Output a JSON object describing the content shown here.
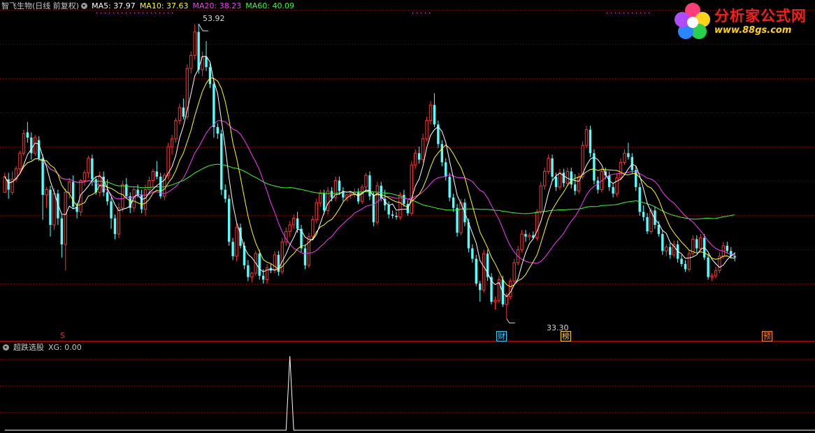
{
  "header": {
    "stock_name": "智飞生物(日线 前复权)",
    "ma_items": [
      {
        "label": "MA5: 37.97",
        "color": "#ffffff"
      },
      {
        "label": "MA10: 37.63",
        "color": "#ffff00"
      },
      {
        "label": "MA20: 38.23",
        "color": "#ff33ff"
      },
      {
        "label": "MA60: 40.09",
        "color": "#33ff33"
      }
    ]
  },
  "logo": {
    "text": "分析家公式网",
    "url": "www.88gs.com"
  },
  "annotations": {
    "high_label": "53.92",
    "low_label": "33.30"
  },
  "markers": [
    {
      "label": "S",
      "color": "#ff2020"
    },
    {
      "label": "财",
      "color": "#33ccff"
    },
    {
      "label": "榜",
      "color": "#ffcc33"
    },
    {
      "label": "预",
      "color": "#ff8833"
    }
  ],
  "indicator": {
    "title": "超跌选股",
    "value_label": "XG: 0.00"
  },
  "colors": {
    "up": "#ff3232",
    "down": "#54ffff",
    "grid": "#8a0000",
    "axis": "#c00000"
  },
  "chart_data": {
    "type": "candlestick",
    "ylim": [
      31,
      55
    ],
    "ohlc": [
      [
        41.0,
        42.5,
        41.2,
        42.2
      ],
      [
        42.0,
        42.5,
        40.5,
        41.2
      ],
      [
        41.0,
        42.6,
        40.8,
        42.0
      ],
      [
        42.0,
        43.0,
        41.8,
        42.8
      ],
      [
        42.8,
        44.2,
        42.5,
        44.0
      ],
      [
        44.0,
        45.8,
        43.8,
        45.5
      ],
      [
        45.6,
        46.4,
        44.8,
        45.2
      ],
      [
        45.2,
        45.6,
        43.5,
        44.0
      ],
      [
        44.0,
        45.4,
        43.8,
        45.2
      ],
      [
        45.0,
        45.3,
        43.4,
        43.6
      ],
      [
        43.6,
        43.9,
        38.9,
        40.8
      ],
      [
        40.8,
        41.4,
        39.8,
        41.2
      ],
      [
        41.2,
        41.5,
        37.6,
        38.5
      ],
      [
        38.5,
        41.3,
        38.1,
        40.9
      ],
      [
        40.9,
        41.2,
        38.5,
        39.0
      ],
      [
        39.0,
        39.3,
        36.0,
        37.0
      ],
      [
        37.0,
        41.3,
        35.0,
        41.0
      ],
      [
        41.0,
        42.1,
        40.5,
        41.8
      ],
      [
        41.8,
        42.3,
        39.7,
        39.9
      ],
      [
        39.9,
        40.2,
        39.0,
        39.5
      ],
      [
        39.5,
        42.0,
        39.2,
        41.9
      ],
      [
        41.9,
        42.7,
        41.5,
        42.5
      ],
      [
        42.5,
        43.8,
        42.1,
        43.6
      ],
      [
        43.6,
        43.9,
        41.5,
        42.0
      ],
      [
        42.0,
        42.2,
        40.8,
        41.0
      ],
      [
        41.0,
        42.6,
        40.7,
        42.2
      ],
      [
        42.2,
        42.6,
        40.7,
        41.0
      ],
      [
        41.0,
        42.0,
        40.0,
        40.3
      ],
      [
        40.3,
        40.6,
        38.2,
        39.0
      ],
      [
        39.0,
        39.3,
        37.4,
        37.8
      ],
      [
        37.8,
        40.2,
        37.5,
        39.8
      ],
      [
        39.8,
        41.9,
        39.5,
        41.6
      ],
      [
        41.6,
        42.1,
        40.5,
        40.7
      ],
      [
        40.7,
        41.0,
        39.4,
        39.8
      ],
      [
        39.8,
        41.4,
        39.5,
        41.2
      ],
      [
        41.2,
        41.6,
        40.6,
        40.8
      ],
      [
        40.8,
        41.2,
        39.4,
        39.7
      ],
      [
        39.7,
        41.6,
        39.2,
        41.2
      ],
      [
        41.2,
        42.2,
        40.8,
        41.9
      ],
      [
        41.9,
        42.8,
        41.4,
        42.6
      ],
      [
        42.6,
        43.4,
        42.0,
        42.2
      ],
      [
        42.2,
        42.5,
        40.5,
        40.7
      ],
      [
        40.7,
        42.5,
        40.4,
        42.3
      ],
      [
        42.3,
        44.8,
        42.0,
        44.5
      ],
      [
        44.5,
        45.4,
        43.9,
        45.1
      ],
      [
        45.1,
        46.7,
        44.8,
        46.5
      ],
      [
        46.5,
        47.8,
        46.2,
        47.5
      ],
      [
        47.5,
        48.2,
        46.6,
        46.8
      ],
      [
        46.8,
        50.8,
        46.6,
        50.5
      ],
      [
        50.5,
        51.8,
        50.1,
        51.5
      ],
      [
        51.5,
        53.9,
        51.2,
        53.3
      ],
      [
        53.3,
        53.92,
        50.1,
        50.4
      ],
      [
        50.4,
        51.8,
        49.9,
        51.4
      ],
      [
        51.4,
        52.6,
        50.3,
        50.6
      ],
      [
        50.6,
        50.9,
        49.0,
        49.3
      ],
      [
        49.3,
        49.6,
        45.2,
        46.0
      ],
      [
        46.0,
        46.3,
        45.1,
        45.5
      ],
      [
        45.5,
        45.8,
        40.8,
        41.2
      ],
      [
        41.2,
        41.6,
        40.2,
        40.5
      ],
      [
        40.5,
        40.8,
        36.9,
        37.2
      ],
      [
        37.2,
        37.5,
        35.8,
        36.1
      ],
      [
        36.1,
        38.6,
        35.7,
        38.3
      ],
      [
        38.3,
        38.6,
        36.7,
        36.9
      ],
      [
        36.9,
        37.2,
        35.1,
        35.4
      ],
      [
        35.4,
        35.8,
        34.2,
        34.5
      ],
      [
        34.5,
        34.9,
        34.1,
        34.8
      ],
      [
        34.8,
        36.5,
        34.6,
        36.3
      ],
      [
        36.3,
        36.6,
        34.3,
        34.6
      ],
      [
        34.6,
        35.1,
        34.0,
        34.3
      ],
      [
        34.3,
        35.5,
        34.0,
        35.2
      ],
      [
        35.2,
        35.5,
        34.8,
        35.0
      ],
      [
        35.0,
        36.5,
        34.8,
        36.2
      ],
      [
        36.2,
        36.5,
        34.6,
        34.9
      ],
      [
        34.9,
        37.5,
        34.7,
        37.2
      ],
      [
        37.2,
        38.3,
        36.9,
        38.0
      ],
      [
        38.0,
        38.8,
        37.6,
        38.5
      ],
      [
        38.5,
        39.3,
        38.2,
        39.0
      ],
      [
        39.0,
        39.5,
        37.9,
        38.2
      ],
      [
        38.2,
        38.5,
        36.4,
        36.7
      ],
      [
        36.7,
        37.0,
        35.1,
        35.4
      ],
      [
        35.4,
        37.9,
        35.2,
        37.6
      ],
      [
        37.6,
        39.2,
        37.3,
        38.9
      ],
      [
        38.9,
        40.5,
        38.6,
        40.2
      ],
      [
        40.2,
        41.2,
        39.9,
        40.9
      ],
      [
        40.9,
        41.2,
        39.3,
        39.6
      ],
      [
        39.6,
        41.4,
        39.3,
        41.1
      ],
      [
        41.1,
        41.4,
        40.3,
        40.6
      ],
      [
        40.6,
        42.2,
        40.3,
        41.9
      ],
      [
        41.9,
        42.2,
        40.8,
        41.1
      ],
      [
        41.1,
        41.4,
        40.3,
        40.6
      ],
      [
        40.6,
        40.9,
        40.3,
        40.8
      ],
      [
        40.8,
        41.1,
        40.5,
        40.9
      ],
      [
        40.9,
        41.3,
        40.6,
        41.0
      ],
      [
        41.0,
        41.3,
        40.1,
        40.3
      ],
      [
        40.3,
        41.6,
        40.1,
        41.4
      ],
      [
        41.4,
        42.5,
        41.2,
        42.3
      ],
      [
        42.3,
        42.6,
        40.4,
        40.7
      ],
      [
        40.7,
        41.0,
        38.4,
        38.7
      ],
      [
        38.7,
        41.8,
        38.5,
        41.5
      ],
      [
        41.5,
        41.8,
        40.3,
        40.5
      ],
      [
        40.5,
        41.2,
        39.6,
        40.0
      ],
      [
        40.0,
        40.3,
        39.0,
        39.3
      ],
      [
        39.3,
        39.6,
        39.0,
        39.2
      ],
      [
        39.2,
        39.5,
        38.9,
        39.1
      ],
      [
        39.1,
        41.0,
        38.9,
        40.8
      ],
      [
        40.8,
        41.2,
        39.9,
        40.1
      ],
      [
        40.1,
        40.4,
        39.2,
        39.4
      ],
      [
        39.4,
        43.4,
        39.2,
        43.1
      ],
      [
        43.1,
        44.3,
        42.8,
        44.0
      ],
      [
        44.0,
        44.5,
        43.2,
        43.5
      ],
      [
        43.5,
        45.5,
        43.3,
        45.1
      ],
      [
        45.1,
        46.8,
        44.9,
        46.5
      ],
      [
        46.5,
        48.0,
        46.2,
        47.7
      ],
      [
        47.7,
        48.6,
        46.0,
        46.2
      ],
      [
        46.2,
        46.5,
        44.4,
        44.7
      ],
      [
        44.7,
        45.0,
        43.0,
        43.3
      ],
      [
        43.3,
        43.6,
        41.9,
        42.2
      ],
      [
        42.2,
        42.5,
        40.3,
        40.6
      ],
      [
        40.6,
        40.9,
        39.5,
        39.8
      ],
      [
        39.8,
        40.1,
        37.6,
        37.9
      ],
      [
        37.9,
        40.5,
        37.7,
        40.2
      ],
      [
        40.2,
        40.5,
        38.4,
        38.7
      ],
      [
        38.7,
        39.0,
        36.4,
        36.7
      ],
      [
        36.7,
        37.0,
        35.6,
        35.9
      ],
      [
        35.9,
        36.2,
        33.8,
        34.0
      ],
      [
        34.0,
        34.2,
        32.6,
        33.5
      ],
      [
        33.5,
        36.6,
        33.3,
        36.3
      ],
      [
        36.3,
        36.6,
        34.2,
        34.5
      ],
      [
        34.5,
        34.8,
        32.4,
        32.6
      ],
      [
        32.6,
        33.0,
        32.0,
        32.7
      ],
      [
        32.7,
        34.6,
        32.5,
        34.3
      ],
      [
        34.3,
        34.6,
        32.2,
        32.4
      ],
      [
        32.4,
        33.3,
        31.3,
        33.0
      ],
      [
        33.0,
        34.4,
        32.8,
        34.2
      ],
      [
        34.2,
        35.9,
        34.0,
        35.6
      ],
      [
        35.6,
        36.9,
        35.4,
        36.6
      ],
      [
        36.6,
        38.1,
        36.4,
        37.8
      ],
      [
        37.8,
        38.1,
        37.2,
        37.6
      ],
      [
        37.6,
        37.9,
        37.3,
        37.7
      ],
      [
        37.7,
        38.0,
        37.4,
        37.5
      ],
      [
        37.5,
        39.7,
        37.3,
        39.5
      ],
      [
        39.5,
        41.8,
        39.3,
        41.5
      ],
      [
        41.5,
        42.9,
        41.2,
        42.6
      ],
      [
        42.6,
        43.9,
        42.4,
        43.6
      ],
      [
        43.6,
        43.9,
        41.9,
        42.2
      ],
      [
        42.2,
        42.5,
        41.1,
        41.4
      ],
      [
        41.4,
        42.8,
        41.2,
        42.5
      ],
      [
        42.5,
        42.8,
        41.4,
        41.7
      ],
      [
        41.7,
        42.9,
        41.5,
        42.6
      ],
      [
        42.6,
        42.9,
        41.3,
        41.6
      ],
      [
        41.6,
        42.4,
        40.8,
        41.1
      ],
      [
        41.1,
        42.5,
        40.9,
        42.2
      ],
      [
        42.2,
        44.9,
        42.0,
        44.6
      ],
      [
        44.6,
        46.1,
        44.4,
        45.8
      ],
      [
        45.8,
        46.1,
        43.7,
        44.0
      ],
      [
        44.0,
        44.3,
        41.6,
        41.9
      ],
      [
        41.9,
        42.2,
        40.9,
        41.2
      ],
      [
        41.2,
        42.9,
        41.0,
        42.6
      ],
      [
        42.6,
        42.9,
        42.0,
        42.3
      ],
      [
        42.3,
        42.6,
        41.1,
        41.4
      ],
      [
        41.4,
        41.7,
        40.6,
        40.9
      ],
      [
        40.9,
        42.4,
        40.7,
        42.1
      ],
      [
        42.1,
        43.6,
        41.9,
        43.3
      ],
      [
        43.3,
        44.3,
        43.1,
        44.0
      ],
      [
        44.0,
        44.8,
        43.5,
        43.7
      ],
      [
        43.7,
        44.0,
        42.4,
        42.7
      ],
      [
        42.7,
        43.0,
        41.1,
        41.4
      ],
      [
        41.4,
        41.7,
        39.2,
        39.5
      ],
      [
        39.5,
        40.0,
        38.8,
        39.1
      ],
      [
        39.1,
        39.4,
        37.8,
        38.0
      ],
      [
        38.0,
        39.8,
        37.8,
        39.6
      ],
      [
        39.6,
        39.9,
        38.2,
        38.5
      ],
      [
        38.5,
        38.8,
        37.6,
        37.8
      ],
      [
        37.8,
        38.1,
        36.2,
        36.5
      ],
      [
        36.5,
        37.0,
        36.1,
        36.8
      ],
      [
        36.8,
        37.1,
        35.9,
        36.2
      ],
      [
        36.2,
        37.3,
        36.0,
        37.0
      ],
      [
        37.0,
        37.3,
        35.6,
        35.9
      ],
      [
        35.9,
        36.2,
        35.3,
        35.5
      ],
      [
        35.5,
        35.8,
        34.9,
        35.1
      ],
      [
        35.1,
        36.6,
        34.9,
        36.3
      ],
      [
        36.3,
        37.7,
        36.1,
        37.4
      ],
      [
        37.4,
        37.7,
        36.4,
        36.7
      ],
      [
        36.7,
        37.8,
        36.5,
        37.5
      ],
      [
        37.5,
        37.8,
        35.8,
        36.0
      ],
      [
        36.0,
        36.3,
        34.3,
        34.5
      ],
      [
        34.5,
        34.8,
        34.2,
        34.6
      ],
      [
        34.6,
        35.3,
        34.4,
        35.0
      ],
      [
        35.0,
        36.4,
        34.8,
        36.1
      ],
      [
        36.1,
        37.2,
        35.9,
        36.9
      ],
      [
        36.9,
        37.2,
        36.3,
        36.5
      ],
      [
        36.5,
        36.8,
        35.9,
        36.1
      ],
      [
        36.1,
        36.4,
        35.7,
        36.0
      ]
    ],
    "indicator_values": [
      0,
      0,
      0,
      0,
      0,
      0,
      0,
      0,
      0,
      0,
      0,
      0,
      0,
      0,
      0,
      0,
      0,
      0,
      0,
      0,
      0,
      0,
      0,
      0,
      0,
      0,
      0,
      0,
      0,
      0,
      0,
      0,
      0,
      0,
      0,
      0,
      0,
      0,
      0,
      0,
      0,
      0,
      0,
      0,
      0,
      0,
      0,
      0,
      0,
      0,
      0,
      0,
      0,
      0,
      0,
      0,
      0,
      0,
      0,
      0,
      0,
      0,
      0,
      0,
      0,
      0,
      0,
      0,
      0,
      0,
      0,
      0,
      0,
      0,
      0,
      1,
      0,
      0,
      0,
      0,
      0,
      0,
      0,
      0,
      0,
      0,
      0,
      0,
      0,
      0,
      0,
      0,
      0,
      0,
      0,
      0,
      0,
      0,
      0,
      0,
      0,
      0,
      0,
      0,
      0,
      0,
      0,
      0,
      0,
      0,
      0,
      0,
      0,
      0,
      0,
      0,
      0,
      0,
      0,
      0,
      0,
      0,
      0,
      0,
      0,
      0,
      0,
      0,
      0,
      0,
      0,
      0,
      0,
      0,
      0,
      0,
      0,
      0,
      0,
      0,
      0,
      0,
      0,
      0,
      0,
      0,
      0,
      0,
      0,
      0,
      0,
      0,
      0,
      0,
      0,
      0,
      0,
      0,
      0,
      0,
      0,
      0,
      0,
      0,
      0,
      0,
      0,
      0,
      0,
      0,
      0,
      0,
      0,
      0,
      0,
      0,
      0,
      0,
      0,
      0,
      0,
      0,
      0,
      0,
      0,
      0,
      0,
      0,
      0,
      0,
      0,
      0,
      0,
      0,
      0,
      0,
      0,
      0,
      0,
      0,
      0,
      0,
      0,
      0,
      0,
      0,
      0,
      0,
      0,
      0,
      0,
      0,
      0,
      0,
      0,
      0,
      0,
      0,
      0,
      0,
      0,
      0
    ]
  }
}
